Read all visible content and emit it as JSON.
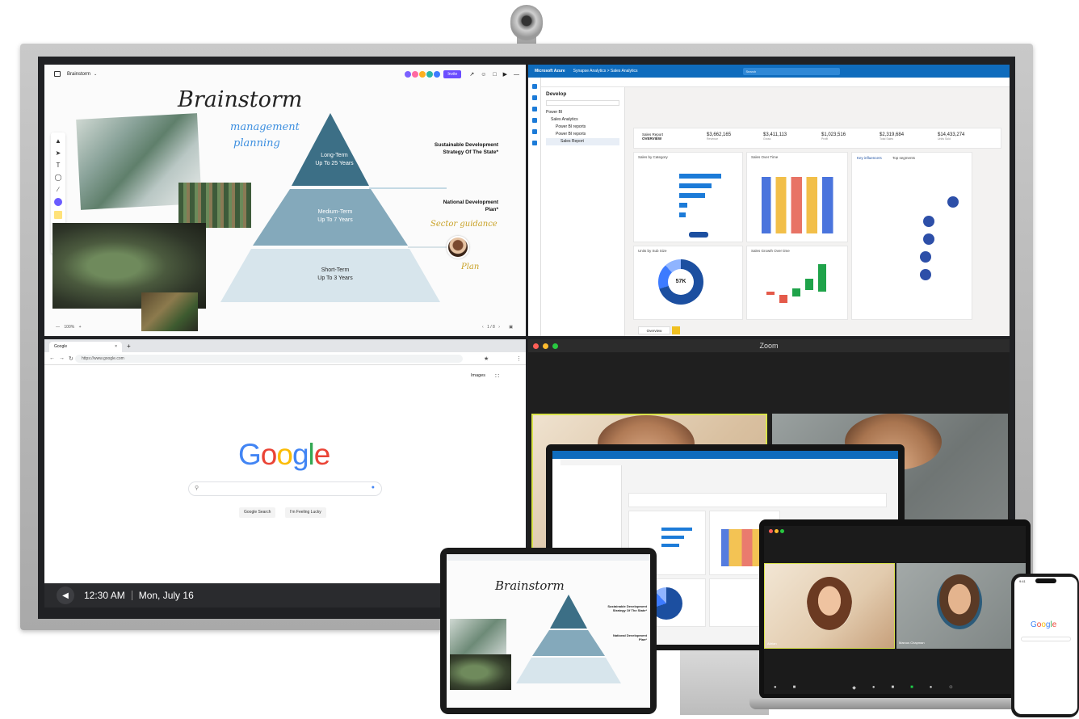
{
  "whiteboard": {
    "app_title": "Brainstorm",
    "invite_label": "Invite",
    "heading": "Brainstorm",
    "subheading_1": "management",
    "subheading_2": "planning",
    "pyramid": {
      "top_line1": "Long-Term",
      "top_line2": "Up To 25 Years",
      "mid_line1": "Medium-Term",
      "mid_line2": "Up To 7 Years",
      "bottom_line1": "Short-Term",
      "bottom_line2": "Up To 3 Years"
    },
    "labels": {
      "sustainable_1": "Sustainable Development",
      "sustainable_2": "Strategy Of The State*",
      "national_1": "National Development",
      "national_2": "Plan*"
    },
    "handwriting": {
      "guidance": "Sector guidance",
      "plan": "Plan"
    },
    "zoom_level": "100%",
    "page_indicator": "1 / 8",
    "collaborator_colors": [
      "#7b61ff",
      "#ff6aa2",
      "#ffb020",
      "#2bb5a5",
      "#3d7bff"
    ],
    "accent_color": "#4f6fff"
  },
  "azure": {
    "brand": "Microsoft Azure",
    "breadcrumb": "Synapse Analytics  >  Sales Analytics",
    "search_placeholder": "Search",
    "panel_title": "Develop",
    "tree": [
      "Power BI",
      "Sales Analytics",
      "Power BI reports",
      "Power BI reports",
      "Sales Report"
    ],
    "report_title_1": "Sales Report",
    "report_title_2": "OVERVIEW",
    "kpis": [
      {
        "value": "$3,662,165",
        "label": "Revenue"
      },
      {
        "value": "$3,411,113",
        "label": "Gross"
      },
      {
        "value": "$1,023,516",
        "label": "Profit"
      },
      {
        "value": "$2,319,684",
        "label": "Total Sales"
      },
      {
        "value": "$14,433,274",
        "label": "Units Sold"
      }
    ],
    "charts": {
      "sales_by_category": "Sales by Category",
      "sales_over_time": "Sales Over Time",
      "key_influencers": "Key influencers",
      "top_segments": "Top segments",
      "units_by_sub_size": "Units by Sub Size",
      "sales_growth": "Sales Growth Over time"
    },
    "donut_center": "57K",
    "tab_label": "Overview"
  },
  "chrome": {
    "tab_title": "Google",
    "url": "https://www.google.com",
    "images_link": "Images",
    "logo_letters": [
      "G",
      "o",
      "o",
      "g",
      "l",
      "e"
    ],
    "logo_colors": [
      "#4285f4",
      "#ea4335",
      "#fbbc05",
      "#4285f4",
      "#34a853",
      "#ea4335"
    ],
    "search_button": "Google Search",
    "lucky_button": "I'm Feeling Lucky"
  },
  "taskbar": {
    "time": "12:30 AM",
    "date": "Mon, July 16"
  },
  "zoom": {
    "title": "Zoom",
    "participants": [
      "Adrian",
      "Marcus Chapman"
    ]
  },
  "phone": {
    "time": "9:41",
    "logo": "Google"
  }
}
